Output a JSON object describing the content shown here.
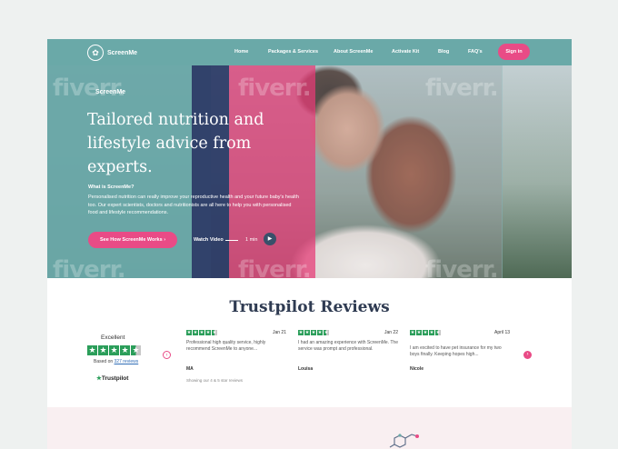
{
  "nav": {
    "logo_text": "ScreenMe",
    "links": [
      "Home",
      "Packages & Services",
      "About ScreenMe",
      "Activate Kit",
      "Blog",
      "FAQ's"
    ],
    "signin_label": "Sign in"
  },
  "hero": {
    "brand": "ScreenMe",
    "title": "Tailored nutrition and lifestyle advice from experts.",
    "subtitle": "What is ScreenMe?",
    "description": "Personalised nutrition can really improve your reproductive health and your future baby's health too. Our expert scientists, doctors and nutritionists are all here to help you with personalised food and lifestyle recommendations.",
    "cta_label": "See How ScreenMe Works",
    "watch_label": "Watch Video",
    "watch_duration": "1 min",
    "watermark": "fiverr."
  },
  "reviews": {
    "title": "Trustpilot Reviews",
    "rating_label": "Excellent",
    "based_prefix": "Based on",
    "based_count": "327 reviews",
    "trustpilot_logo": "Trustpilot",
    "showing": "Showing our 4 & 5 star reviews",
    "items": [
      {
        "stars": 4.5,
        "date": "Jan 21",
        "text": "Professional high quality service, highly recommend ScreenMe to anyone...",
        "name": "MA"
      },
      {
        "stars": 4.5,
        "date": "Jan 22",
        "text": "I had an amazing experience with ScreenMe. The service was prompt and professional.",
        "name": "Louisa"
      },
      {
        "stars": 4.5,
        "date": "April 13",
        "text": "I am excited to have pet insurance for my two boys finally. Keeping hopes high...",
        "name": "Nicole"
      }
    ]
  },
  "colors": {
    "accent_pink": "#e94b86",
    "teal": "#6aa9a8",
    "navy": "#2f3b52",
    "trustpilot_green": "#2b9e5a"
  }
}
